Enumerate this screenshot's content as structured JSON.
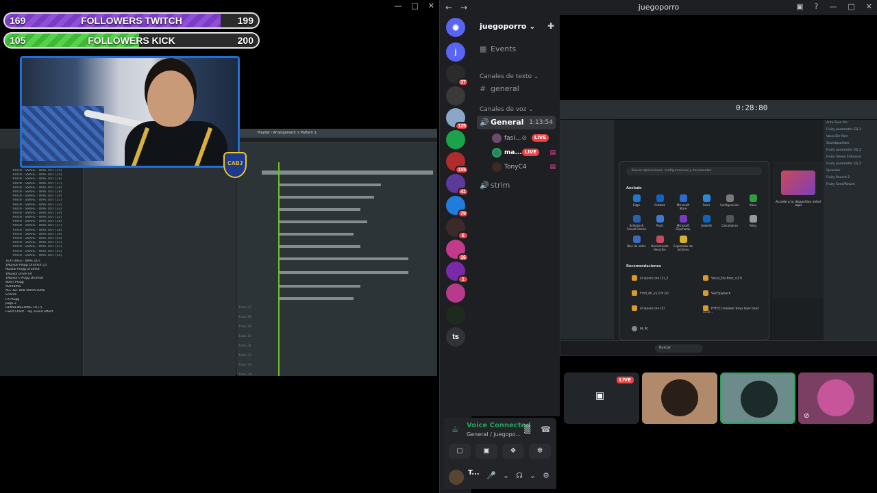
{
  "overlay": {
    "twitch": {
      "current": "169",
      "label": "FOLLOWERS TWITCH",
      "goal": "199",
      "progress_pct": 85
    },
    "kick": {
      "current": "105",
      "label": "FOLLOWERS KICK",
      "goal": "200",
      "progress_pct": 53
    },
    "badge": "CABJ"
  },
  "daw": {
    "browser_items": [
      "#RUN - SNARE - WIPE OUT (24)",
      "#RUN - SNARE - WIPE OUT (25)",
      "#RUN - SNARE - WIPE OUT (26)",
      "#RUN - SNARE - WIPE OUT (27)",
      "#RUN - SNARE - WIPE OUT (28)",
      "#RUN - SNARE - WIPE OUT (29)",
      "#RUN - SNARE - WIPE OUT (30)",
      "#RUN - SNARE - WIPE OUT (31)",
      "#RUN - SNARE - WIPE OUT (32)",
      "#RUN - SNARE - WIPE OUT (33)",
      "#RUN - SNARE - WIPE OUT (34)",
      "#RUN - SNARE - WIPE OUT (35)",
      "#RUN - SNARE - WIPE OUT (36)",
      "#RUN - SNARE - WIPE OUT (37)",
      "#RUN - SNARE - WIPE OUT (38)",
      "#RUN - SNARE - WIPE OUT (39)",
      "#RUN - SNARE - WIPE OUT (40)",
      "#RUN - SNARE - WIPE OUT (41)",
      "#RUN - SNARE - WIPE OUT (42)",
      "#RUN - SNARE - WIPE OUT (43)",
      "#RUN - SNARE - WIPE OUT (44)"
    ],
    "browser_folders": [
      "TEXTURES - WIPE OUT",
      "1Nujikai Plugg Drumkit (2)",
      "Nujikai Plugg Drumkit",
      "1Nujika Drum kit",
      "1Nujika's Plugg Drumkit",
      "808's Plugg",
      "ADHIBINS",
      "ALL 1ST 808 VARIATIONS",
      "Chants",
      "FX Plugg",
      "page 2",
      "DEMBEWEEDING 18 (?)",
      "Fixed Chant - Top sound effect"
    ],
    "playlist_title": "Playlist - Arrangement > Pattern 1",
    "track_labels": [
      "Track 27",
      "Track 28",
      "Track 29",
      "Track 30",
      "Track 31",
      "Track 32",
      "Track 33",
      "Track 34"
    ]
  },
  "discord": {
    "window_title": "juegoporro",
    "guild_name": "juegoporro",
    "events_label": "Events",
    "text_category": "Canales de texto",
    "text_channel": "general",
    "voice_category": "Canales de voz",
    "voice_channel": "General",
    "voice_timer": "1:13:54",
    "voice_users": [
      {
        "name": "fasi...",
        "live": "LIVE"
      },
      {
        "name": "ma...",
        "live": "LIVE"
      },
      {
        "name": "TonyC4",
        "live": ""
      }
    ],
    "other_voice_channel": "strim",
    "servers": [
      {
        "label": "j",
        "badge": ""
      },
      {
        "label": "",
        "badge": "37"
      },
      {
        "label": "",
        "badge": ""
      },
      {
        "label": "",
        "badge": "125"
      },
      {
        "label": "",
        "badge": ""
      },
      {
        "label": "",
        "badge": "155"
      },
      {
        "label": "",
        "badge": "41"
      },
      {
        "label": "",
        "badge": "79"
      },
      {
        "label": "",
        "badge": "6"
      },
      {
        "label": "",
        "badge": "16"
      },
      {
        "label": "",
        "badge": "1"
      },
      {
        "label": "",
        "badge": ""
      },
      {
        "label": "",
        "badge": ""
      },
      {
        "label": "ts",
        "badge": ""
      }
    ],
    "voice_status": "Voice Connected",
    "voice_location": "General / juegopo...",
    "user_name": "T...",
    "tile_live": "LIVE"
  },
  "shared_screen": {
    "time": "0:28:80",
    "search_placeholder": "Buscar aplicaciones, configuraciones y documentos",
    "pinned_label": "Anclado",
    "apps": [
      "Edge",
      "Outlook",
      "Microsoft Store",
      "Fotos",
      "Configuración",
      "Xbox",
      "Solitaire & Casual Games",
      "Paint",
      "Microsoft Clipchamp",
      "LinkedIn",
      "Calculadora",
      "Reloj",
      "Bloc de notas",
      "Herramienta Recortes",
      "Explorador de archivos"
    ],
    "recommended_label": "Recomendaciones",
    "recommended": [
      "el quiere oro (2)_2",
      "Vocal_Ele-fixer_v3.0",
      "Fmfl_All_v1.0.9 (2)",
      "ValcSpyback",
      "el quiere oro (2)",
      "[FREE] sneaker boys type beat v3.0..."
    ],
    "phone_title": "Accede a tu dispositivo móvil aquí",
    "right_panel": [
      "Auto-Tune Pro",
      "Fruity parametric EQ 2",
      "Vocal Ele-fixer",
      "Soundgoodizer",
      "Fruity parametric EQ 2",
      "Fruity Stereo Enhancer",
      "Fruity parametric EQ 2",
      "Spreader",
      "Fruity Reverb 2",
      "Fruity Send/Return"
    ],
    "taskbar_search": "Buscar",
    "taskbar_user": "Mi PC"
  }
}
